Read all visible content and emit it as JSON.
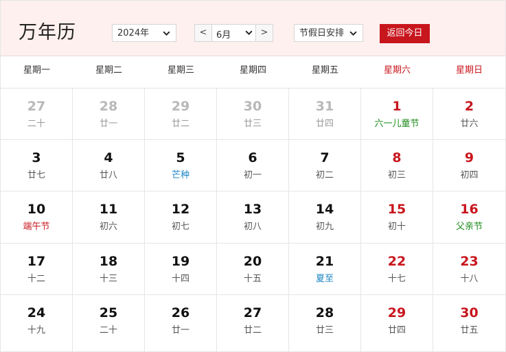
{
  "header": {
    "title": "万年历",
    "year_select": "2024年",
    "month_prev": "<",
    "month_select": "6月",
    "month_next": ">",
    "holiday_select": "节假日安排",
    "today_button": "返回今日"
  },
  "weekdays": [
    "星期一",
    "星期二",
    "星期三",
    "星期四",
    "星期五",
    "星期六",
    "星期日"
  ],
  "weeks": [
    [
      {
        "day": "27",
        "lunar": "二十",
        "other": true
      },
      {
        "day": "28",
        "lunar": "廿一",
        "other": true
      },
      {
        "day": "29",
        "lunar": "廿二",
        "other": true
      },
      {
        "day": "30",
        "lunar": "廿三",
        "other": true
      },
      {
        "day": "31",
        "lunar": "廿四",
        "other": true
      },
      {
        "day": "1",
        "lunar": "六一儿童节",
        "type": "fest"
      },
      {
        "day": "2",
        "lunar": "廿六"
      }
    ],
    [
      {
        "day": "3",
        "lunar": "廿七"
      },
      {
        "day": "4",
        "lunar": "廿八"
      },
      {
        "day": "5",
        "lunar": "芒种",
        "type": "term"
      },
      {
        "day": "6",
        "lunar": "初一"
      },
      {
        "day": "7",
        "lunar": "初二"
      },
      {
        "day": "8",
        "lunar": "初三"
      },
      {
        "day": "9",
        "lunar": "初四"
      }
    ],
    [
      {
        "day": "10",
        "lunar": "端午节",
        "type": "red"
      },
      {
        "day": "11",
        "lunar": "初六"
      },
      {
        "day": "12",
        "lunar": "初七"
      },
      {
        "day": "13",
        "lunar": "初八"
      },
      {
        "day": "14",
        "lunar": "初九"
      },
      {
        "day": "15",
        "lunar": "初十"
      },
      {
        "day": "16",
        "lunar": "父亲节",
        "type": "fest"
      }
    ],
    [
      {
        "day": "17",
        "lunar": "十二"
      },
      {
        "day": "18",
        "lunar": "十三"
      },
      {
        "day": "19",
        "lunar": "十四"
      },
      {
        "day": "20",
        "lunar": "十五"
      },
      {
        "day": "21",
        "lunar": "夏至",
        "type": "term"
      },
      {
        "day": "22",
        "lunar": "十七"
      },
      {
        "day": "23",
        "lunar": "十八"
      }
    ],
    [
      {
        "day": "24",
        "lunar": "十九"
      },
      {
        "day": "25",
        "lunar": "二十"
      },
      {
        "day": "26",
        "lunar": "廿一"
      },
      {
        "day": "27",
        "lunar": "廿二"
      },
      {
        "day": "28",
        "lunar": "廿三"
      },
      {
        "day": "29",
        "lunar": "廿四"
      },
      {
        "day": "30",
        "lunar": "廿五"
      }
    ]
  ],
  "colors": {
    "accent": "#c8161d",
    "header_bg": "#fdf0ee",
    "festival": "#1a8a1a",
    "solar_term": "#1b85c4",
    "other_month": "#b8b8b8"
  },
  "icons": {
    "dropdown": "chevron-down-icon"
  }
}
